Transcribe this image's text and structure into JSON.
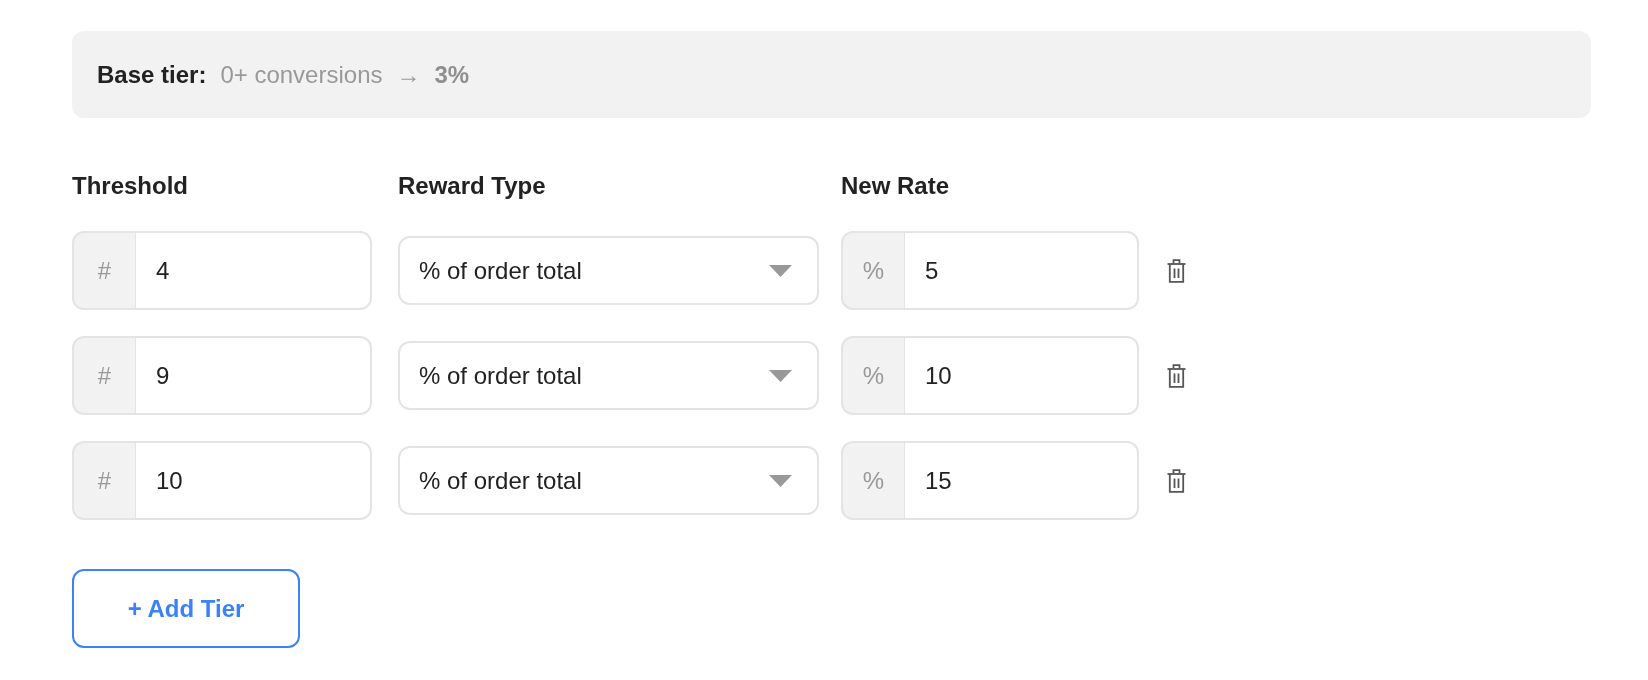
{
  "base_tier": {
    "label": "Base tier:",
    "conversions": "0+ conversions",
    "arrow": "→",
    "rate": "3%"
  },
  "columns": [
    "Threshold",
    "Reward Type",
    "New Rate"
  ],
  "tiers": [
    {
      "threshold_prefix": "#",
      "threshold": "4",
      "reward_type": "% of order total",
      "rate_prefix": "%",
      "rate": "5"
    },
    {
      "threshold_prefix": "#",
      "threshold": "9",
      "reward_type": "% of order total",
      "rate_prefix": "%",
      "rate": "10"
    },
    {
      "threshold_prefix": "#",
      "threshold": "10",
      "reward_type": "% of order total",
      "rate_prefix": "%",
      "rate": "15"
    }
  ],
  "add_button": "+ Add Tier"
}
